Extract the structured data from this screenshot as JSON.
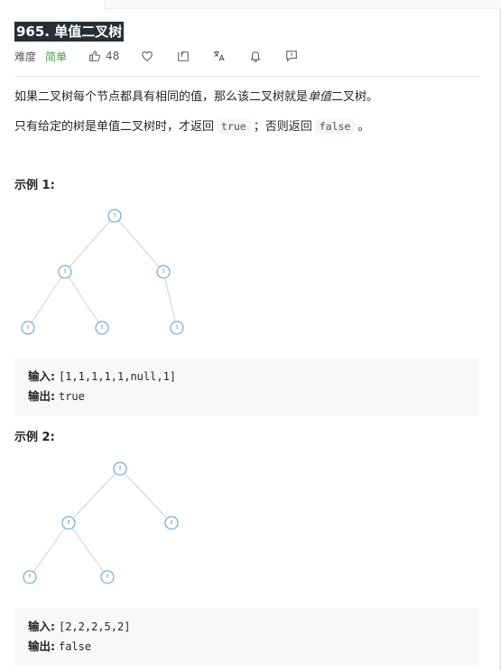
{
  "problem": {
    "title": "965. 单值二叉树",
    "difficulty_label": "难度",
    "difficulty_value": "简单",
    "likes": "48"
  },
  "description": {
    "p1_before": "如果二叉树每个节点都具有相同的值，那么该二叉树就是",
    "p1_em": "单值",
    "p1_after": "二叉树。",
    "p2_before": "只有给定的树是单值二叉树时，才返回",
    "p2_code1": "true",
    "p2_middle": "；否则返回",
    "p2_code2": "false",
    "p2_after": "。"
  },
  "examples": [
    {
      "title": "示例 1:",
      "input_label": "输入:",
      "input_value": "[1,1,1,1,1,null,1]",
      "output_label": "输出:",
      "output_value": "true",
      "nodes": [
        "1",
        "1",
        "1",
        "1",
        "1",
        "1"
      ]
    },
    {
      "title": "示例 2:",
      "input_label": "输入:",
      "input_value": "[2,2,2,5,2]",
      "output_label": "输出:",
      "output_value": "false",
      "nodes": [
        "2",
        "2",
        "2",
        "5",
        "2"
      ]
    }
  ],
  "toolbar_icons": [
    "thumbs-up-icon",
    "heart-icon",
    "share-icon",
    "translate-icon",
    "bell-icon",
    "feedback-icon"
  ]
}
